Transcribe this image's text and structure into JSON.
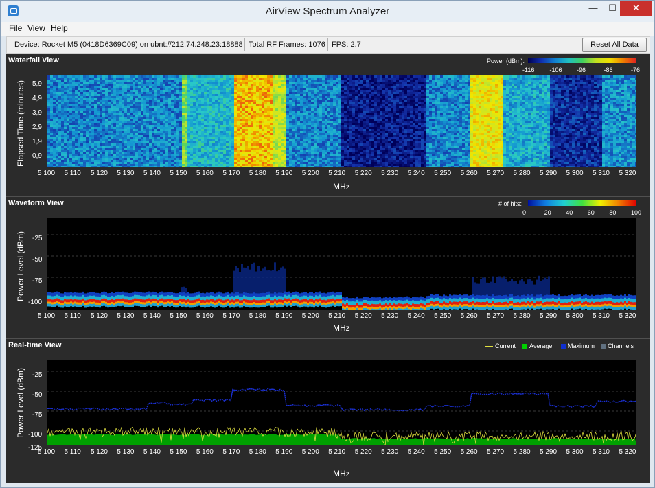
{
  "window": {
    "title": "AirView Spectrum Analyzer",
    "min_glyph": "—",
    "max_glyph": "☐",
    "close_glyph": "✕"
  },
  "menu": [
    "File",
    "View",
    "Help"
  ],
  "toolbar": {
    "device": "Device: Rocket M5 (0418D6369C09) on ubnt://212.74.248.23:18888",
    "frames": "Total RF Frames: 1076",
    "fps": "FPS: 2.7",
    "reset_label": "Reset All Data"
  },
  "x_ticks": [
    "5 100",
    "5 110",
    "5 120",
    "5 130",
    "5 140",
    "5 150",
    "5 160",
    "5 170",
    "5 180",
    "5 190",
    "5 200",
    "5 210",
    "5 220",
    "5 230",
    "5 240",
    "5 250",
    "5 260",
    "5 270",
    "5 280",
    "5 290",
    "5 300",
    "5 310",
    "5 320"
  ],
  "x_tick_values": [
    5100,
    5110,
    5120,
    5130,
    5140,
    5150,
    5160,
    5170,
    5180,
    5190,
    5200,
    5210,
    5220,
    5230,
    5240,
    5250,
    5260,
    5270,
    5280,
    5290,
    5300,
    5310,
    5320
  ],
  "x_unit": "MHz",
  "waterfall": {
    "title": "Waterfall View",
    "ylabel": "Elapsed Time (minutes)",
    "yticks": [
      "5,9",
      "4,9",
      "3,9",
      "2,9",
      "1,9",
      "0,9"
    ],
    "legend_title": "Power (dBm):",
    "legend_ticks": [
      "-116",
      "-106",
      "-96",
      "-86",
      "-76"
    ]
  },
  "waveform": {
    "title": "Waveform View",
    "ylabel": "Power Level (dBm)",
    "yticks": [
      "-25",
      "-50",
      "-75",
      "-100"
    ],
    "legend_title": "# of hits:",
    "legend_ticks": [
      "0",
      "20",
      "40",
      "60",
      "80",
      "100"
    ]
  },
  "realtime": {
    "title": "Real-time View",
    "ylabel": "Power Level (dBm)",
    "yticks": [
      "-25",
      "-50",
      "-75",
      "-100",
      "-125"
    ],
    "legend": [
      {
        "label": "Current",
        "color": "#e0e040"
      },
      {
        "label": "Average",
        "color": "#00d000"
      },
      {
        "label": "Maximum",
        "color": "#1030d0"
      },
      {
        "label": "Channels",
        "color": "#607080"
      }
    ]
  },
  "colors": {
    "accent_yellow": "#f0f000",
    "accent_green": "#00b000",
    "accent_blue": "#1a2fd0",
    "hot_red": "#e02020"
  }
}
